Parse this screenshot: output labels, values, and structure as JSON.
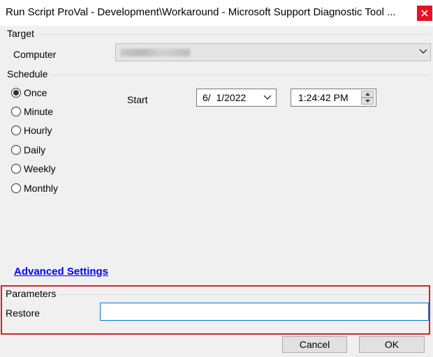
{
  "window": {
    "title": "Run Script ProVal - Development\\Workaround - Microsoft Support Diagnostic Tool ...",
    "close_icon": "close-icon"
  },
  "target": {
    "group_label": "Target",
    "computer_label": "Computer"
  },
  "schedule": {
    "group_label": "Schedule",
    "options": [
      {
        "label": "Once",
        "checked": true
      },
      {
        "label": "Minute",
        "checked": false
      },
      {
        "label": "Hourly",
        "checked": false
      },
      {
        "label": "Daily",
        "checked": false
      },
      {
        "label": "Weekly",
        "checked": false
      },
      {
        "label": "Monthly",
        "checked": false
      }
    ],
    "start_label": "Start",
    "date_value": "6/  1/2022",
    "time_value": "1:24:42 PM"
  },
  "advanced_settings_link": "Advanced Settings",
  "parameters": {
    "group_label": "Parameters",
    "restore_label": "Restore",
    "restore_value": ""
  },
  "buttons": {
    "cancel": "Cancel",
    "ok": "OK"
  },
  "colors": {
    "close_button": "#e81123",
    "highlight_box": "#d0212c",
    "link": "#0000ff",
    "input_focus_border": "#0078d7"
  }
}
